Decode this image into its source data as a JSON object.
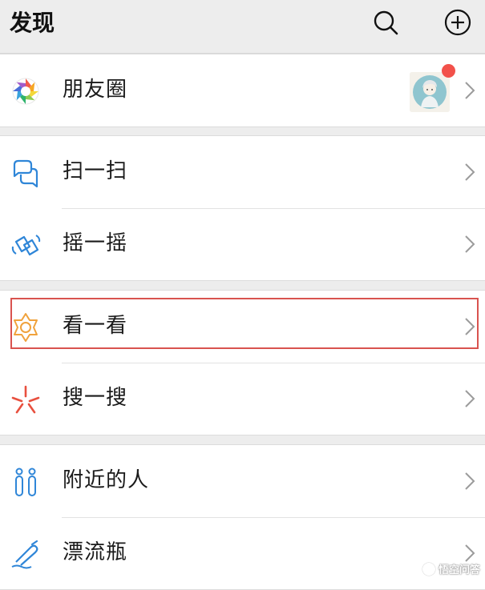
{
  "header": {
    "title": "发现",
    "search_icon": "search-icon",
    "add_icon": "plus-circle-icon"
  },
  "menu": {
    "moments": {
      "label": "朋友圈",
      "icon": "moments-aperture-icon",
      "has_badge": true
    },
    "scan": {
      "label": "扫一扫",
      "icon": "scan-icon"
    },
    "shake": {
      "label": "摇一摇",
      "icon": "shake-icon"
    },
    "top_stories": {
      "label": "看一看",
      "icon": "top-stories-icon",
      "highlighted": true
    },
    "search": {
      "label": "搜一搜",
      "icon": "search-spark-icon"
    },
    "people_nearby": {
      "label": "附近的人",
      "icon": "people-nearby-icon"
    },
    "drift_bottle": {
      "label": "漂流瓶",
      "icon": "drift-bottle-icon"
    }
  },
  "watermark": {
    "text": "悟空问答"
  },
  "colors": {
    "background": "#ededed",
    "card": "#ffffff",
    "badge": "#f2514a",
    "highlight_border": "#d9534f",
    "scan_blue": "#2f86d8",
    "top_stories_orange": "#f0a23c",
    "search_red": "#e8503f"
  }
}
